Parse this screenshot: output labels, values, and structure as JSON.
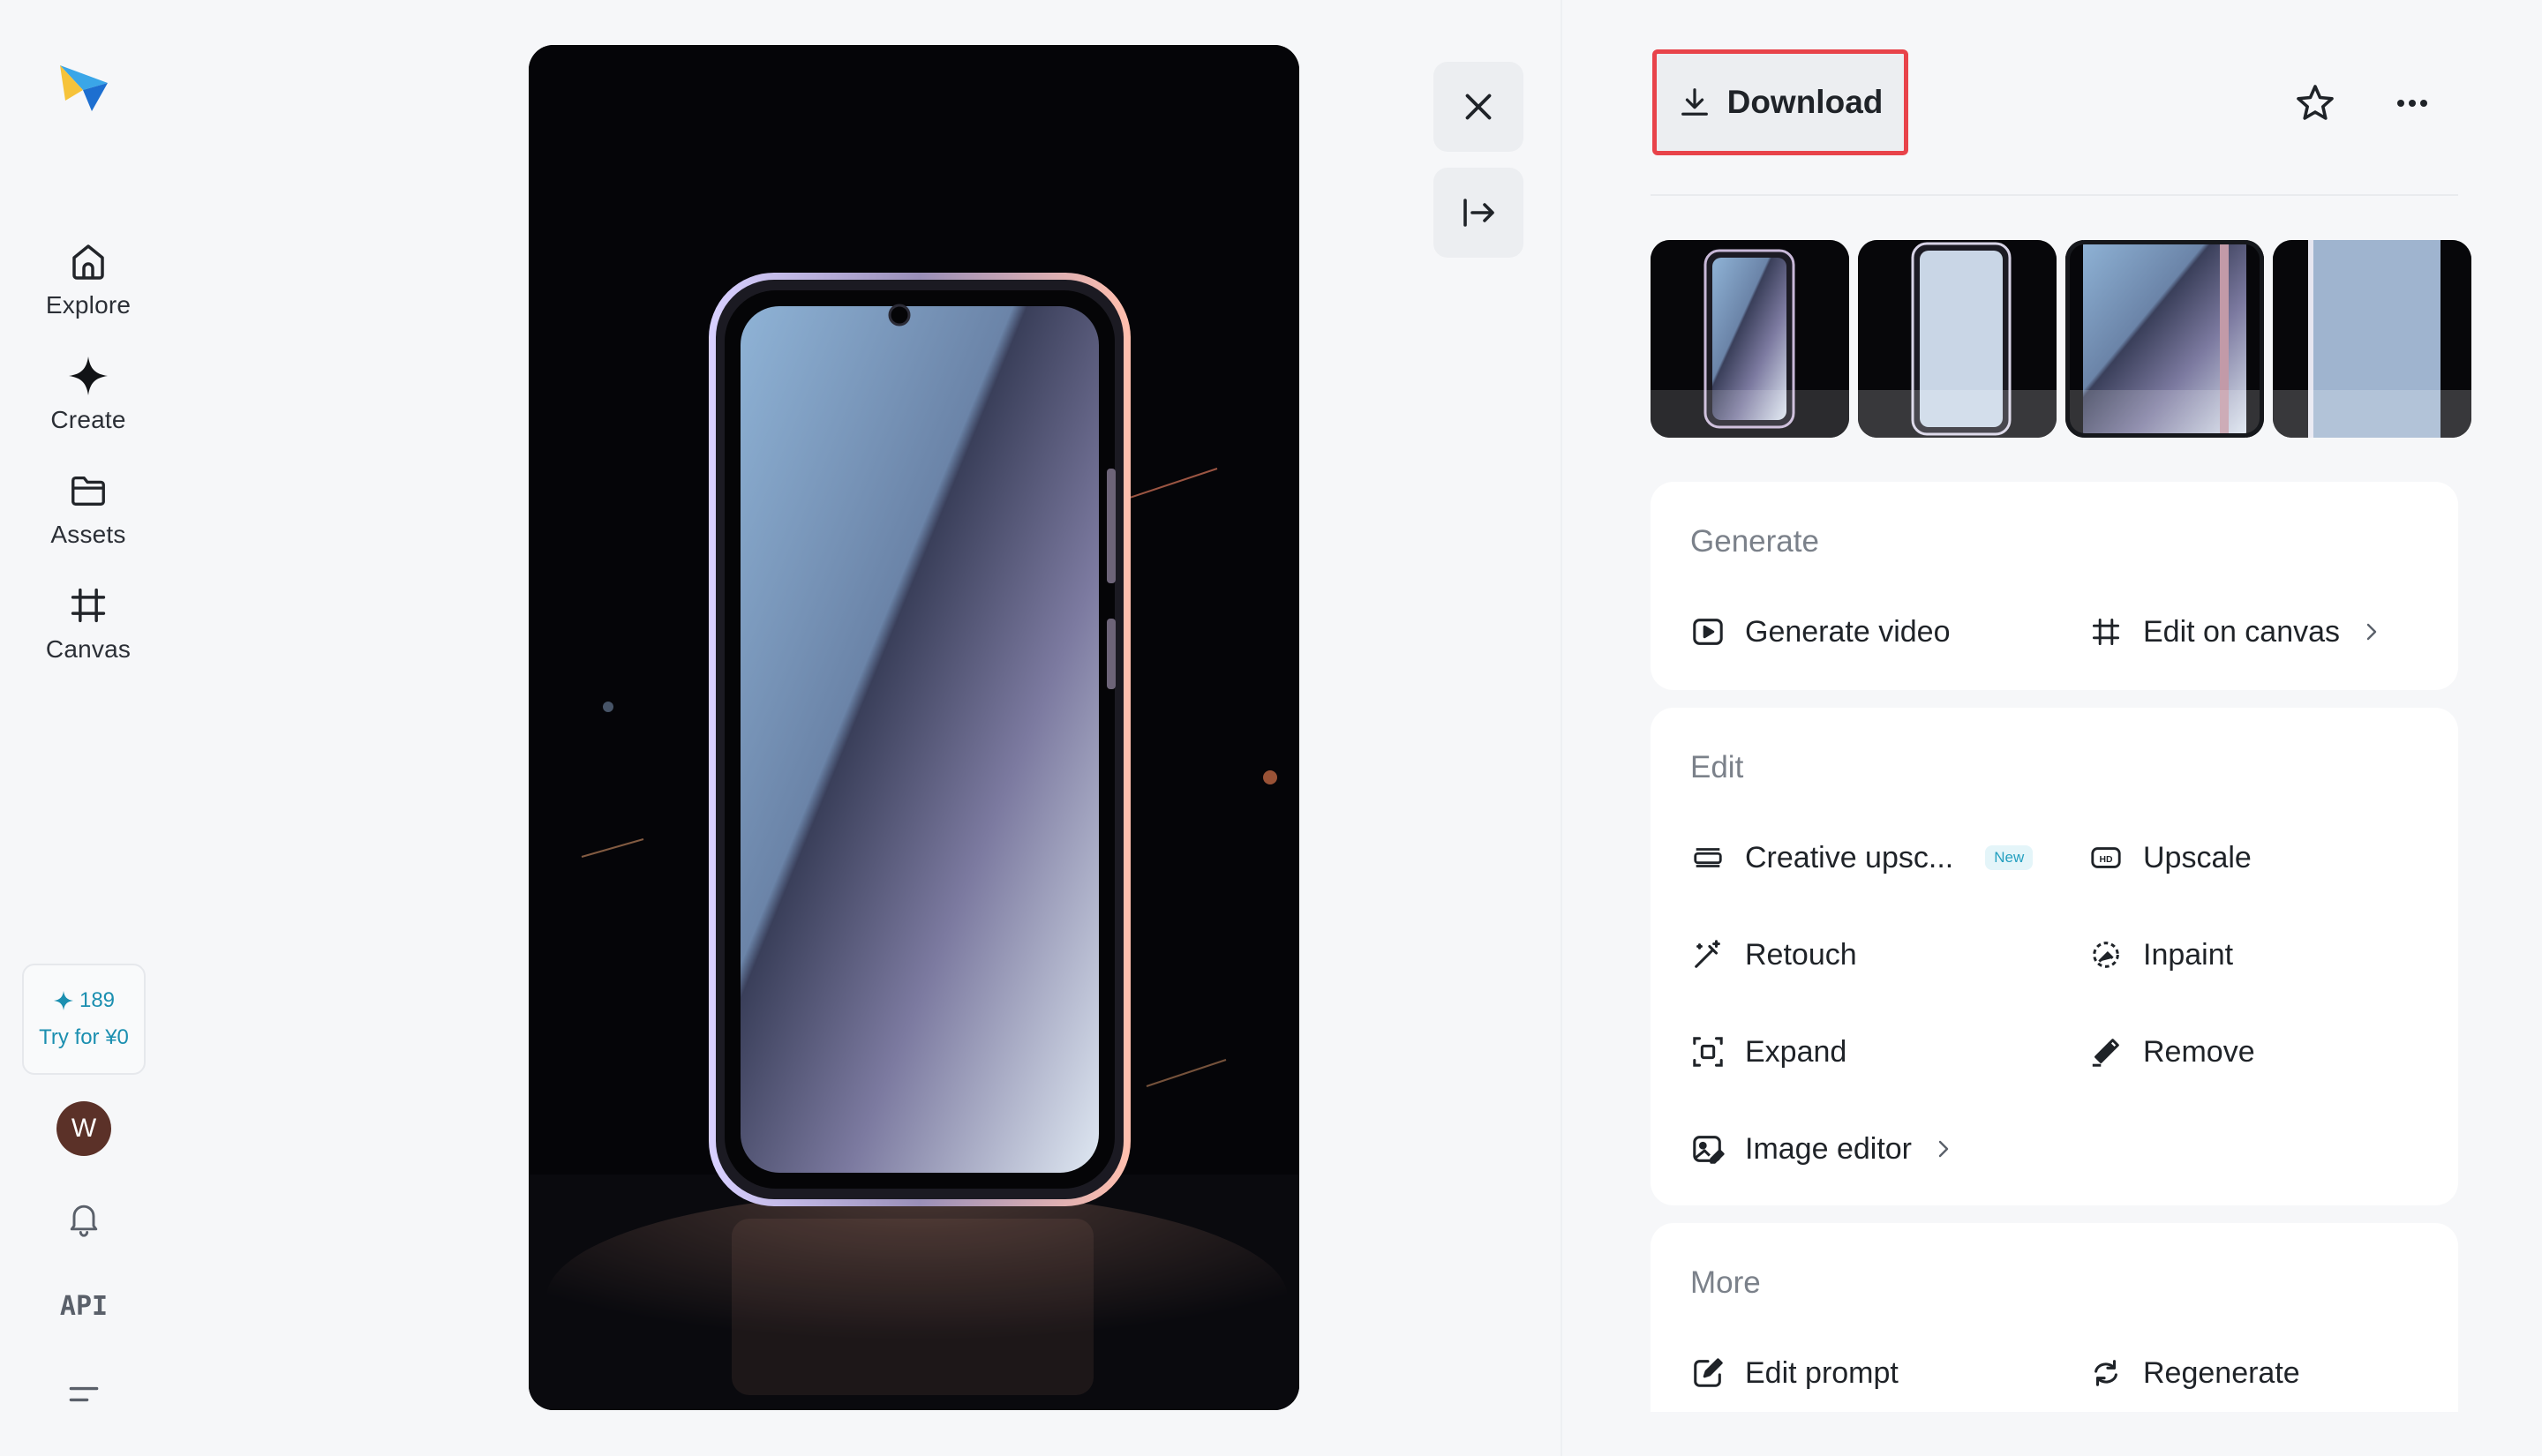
{
  "sidebar": {
    "logo": "app-logo",
    "items": [
      {
        "label": "Explore",
        "icon": "home-icon"
      },
      {
        "label": "Create",
        "icon": "sparkle-icon"
      },
      {
        "label": "Assets",
        "icon": "folder-icon"
      },
      {
        "label": "Canvas",
        "icon": "crop-icon"
      }
    ],
    "credits": {
      "count": "189",
      "trial": "Try for ¥0"
    },
    "avatar_initial": "W",
    "api_label": "API"
  },
  "toolbar": {
    "download_label": "Download",
    "favorite_icon": "star-icon",
    "more_icon": "more-icon",
    "close_icon": "close-icon",
    "collapse_icon": "collapse-panel-icon"
  },
  "thumbnails": [
    {
      "selected": false
    },
    {
      "selected": false
    },
    {
      "selected": true
    },
    {
      "selected": false
    }
  ],
  "generate": {
    "title": "Generate",
    "actions": [
      {
        "label": "Generate video",
        "icon": "play-icon"
      },
      {
        "label": "Edit on canvas",
        "icon": "crop-icon"
      }
    ]
  },
  "edit": {
    "title": "Edit",
    "new_badge": "New",
    "actions": [
      {
        "label": "Creative upsc...",
        "icon": "hd-plus-icon"
      },
      {
        "label": "Upscale",
        "icon": "hd-icon"
      },
      {
        "label": "Retouch",
        "icon": "magic-wand-icon"
      },
      {
        "label": "Inpaint",
        "icon": "inpaint-icon"
      },
      {
        "label": "Expand",
        "icon": "expand-icon"
      },
      {
        "label": "Remove",
        "icon": "eraser-icon"
      },
      {
        "label": "Image editor",
        "icon": "image-edit-icon"
      }
    ]
  },
  "more": {
    "title": "More",
    "actions": [
      {
        "label": "Edit prompt",
        "icon": "edit-icon"
      },
      {
        "label": "Regenerate",
        "icon": "regenerate-icon"
      }
    ]
  },
  "colors": {
    "accent": "#1b8fb0",
    "highlight": "#e8434a",
    "background": "#f6f7f9"
  }
}
